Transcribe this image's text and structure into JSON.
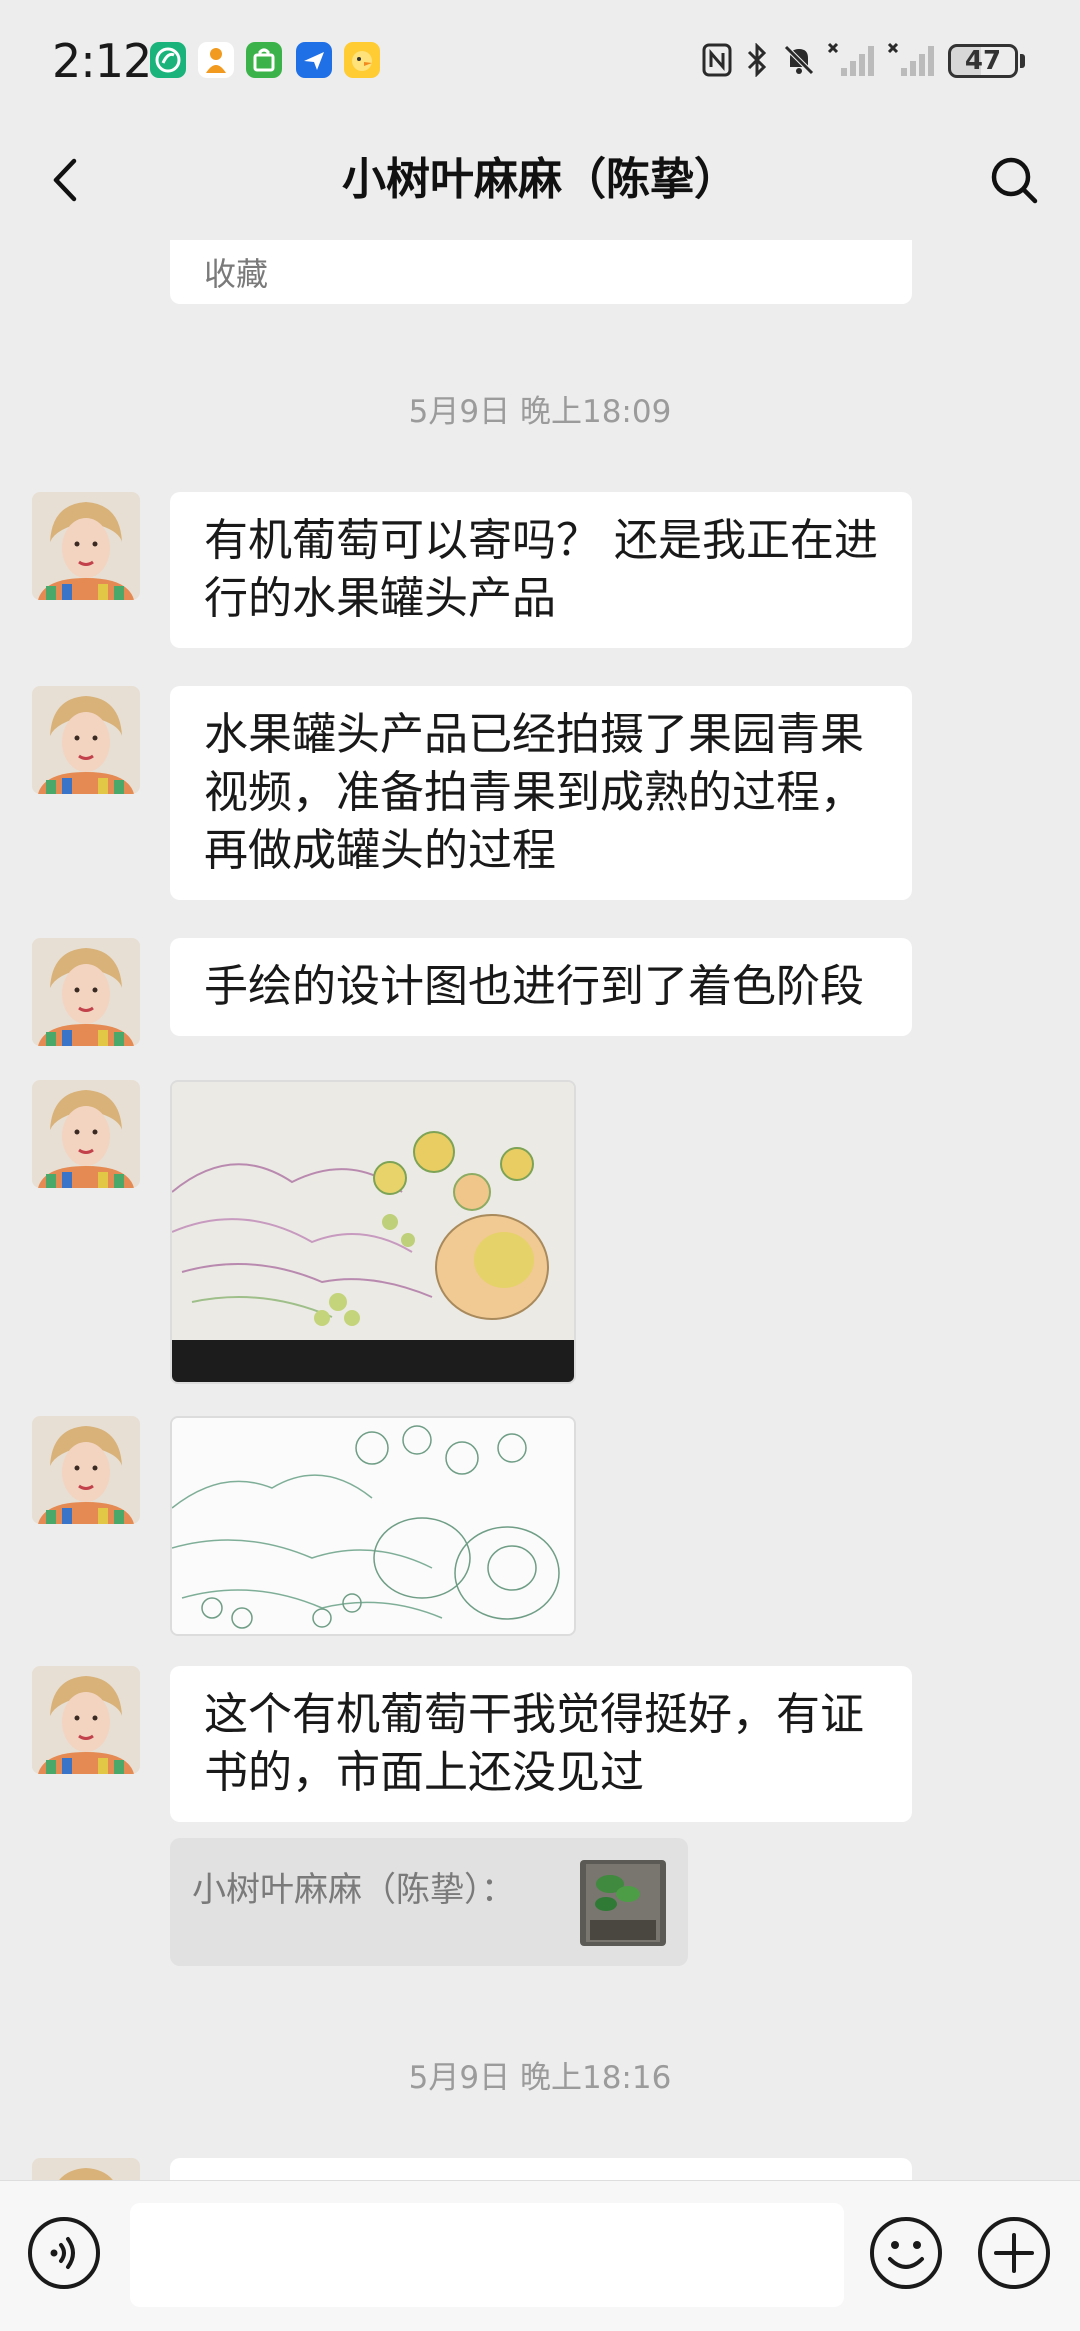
{
  "status_bar": {
    "time": "2:12",
    "battery": "47",
    "app_icons": [
      "leaf-app-icon",
      "person-app-icon",
      "shopping-bag-app-icon",
      "airplane-app-icon",
      "duck-app-icon"
    ],
    "system_icons": [
      "nfc-icon",
      "bluetooth-icon",
      "mute-bell-icon",
      "signal-icon",
      "signal-icon"
    ]
  },
  "header": {
    "title": "小树叶麻麻（陈挚）"
  },
  "messages": {
    "collect_label": "收藏",
    "time_1": "5月9日 晚上18:09",
    "msg_1": "有机葡萄可以寄吗？ 还是我正在进行的水果罐头产品",
    "msg_2": "水果罐头产品已经拍摄了果园青果视频，准备拍青果到成熟的过程，再做成罐头的过程",
    "msg_3": "手绘的设计图也进行到了着色阶段",
    "msg_4": "这个有机葡萄干我觉得挺好，有证书的，市面上还没见过",
    "quote_sender": "小树叶麻麻（陈挚）：",
    "time_2": "5月9日 晚上18:16"
  },
  "input": {
    "value": "",
    "placeholder": ""
  },
  "colors": {
    "background": "#ededed",
    "bubble": "#ffffff",
    "timestamp": "#9b9b9b",
    "quote_bg": "#e1e1e1"
  }
}
